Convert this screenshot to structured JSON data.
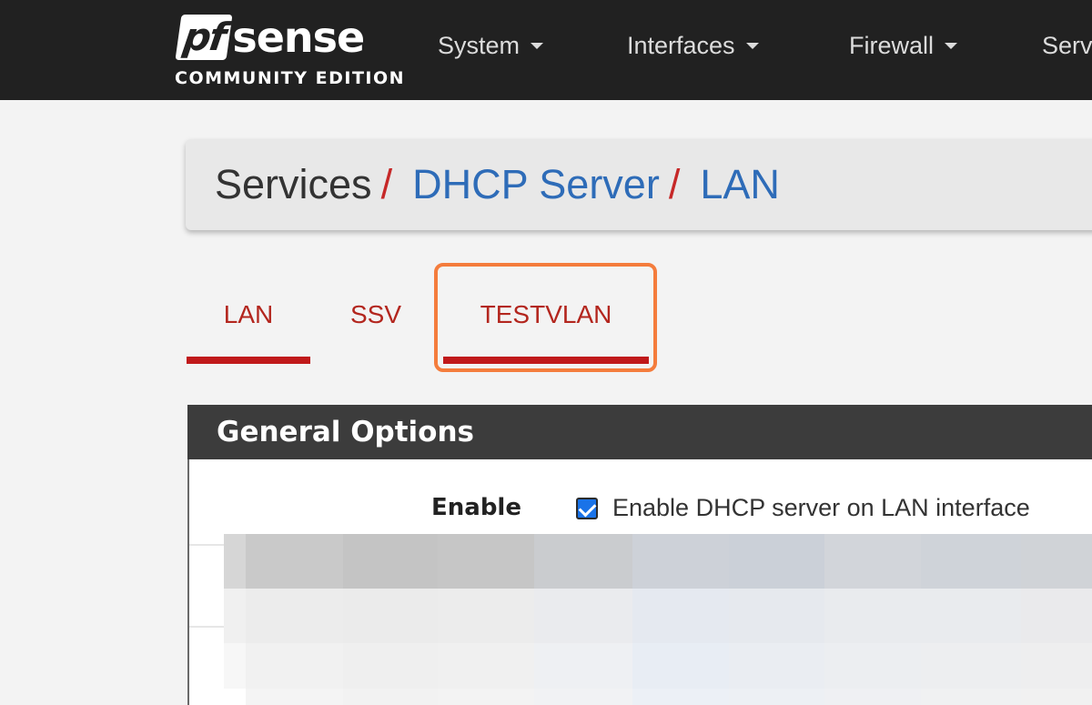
{
  "brand": {
    "logo_pf": "pf",
    "logo_sense": "sense",
    "edition": "COMMUNITY EDITION"
  },
  "nav": {
    "items": [
      {
        "label": "System"
      },
      {
        "label": "Interfaces"
      },
      {
        "label": "Firewall"
      },
      {
        "label": "Serv"
      }
    ]
  },
  "breadcrumb": {
    "root": "Services",
    "separator": "/",
    "links": [
      "DHCP Server",
      "LAN"
    ]
  },
  "tabs": [
    {
      "label": "LAN",
      "active": true
    },
    {
      "label": "SSV",
      "active": false
    },
    {
      "label": "TESTVLAN",
      "active": true,
      "highlighted": true
    }
  ],
  "panel": {
    "title": "General Options",
    "enable_label": "Enable",
    "enable_checkbox_text": "Enable DHCP server on LAN interface",
    "enable_checked": true
  },
  "colors": {
    "navbar": "#212121",
    "tab_red": "#c0191a",
    "link_blue": "#2e6cb8",
    "highlight_orange": "#f47c3c",
    "panel_head": "#3c3c3c"
  }
}
